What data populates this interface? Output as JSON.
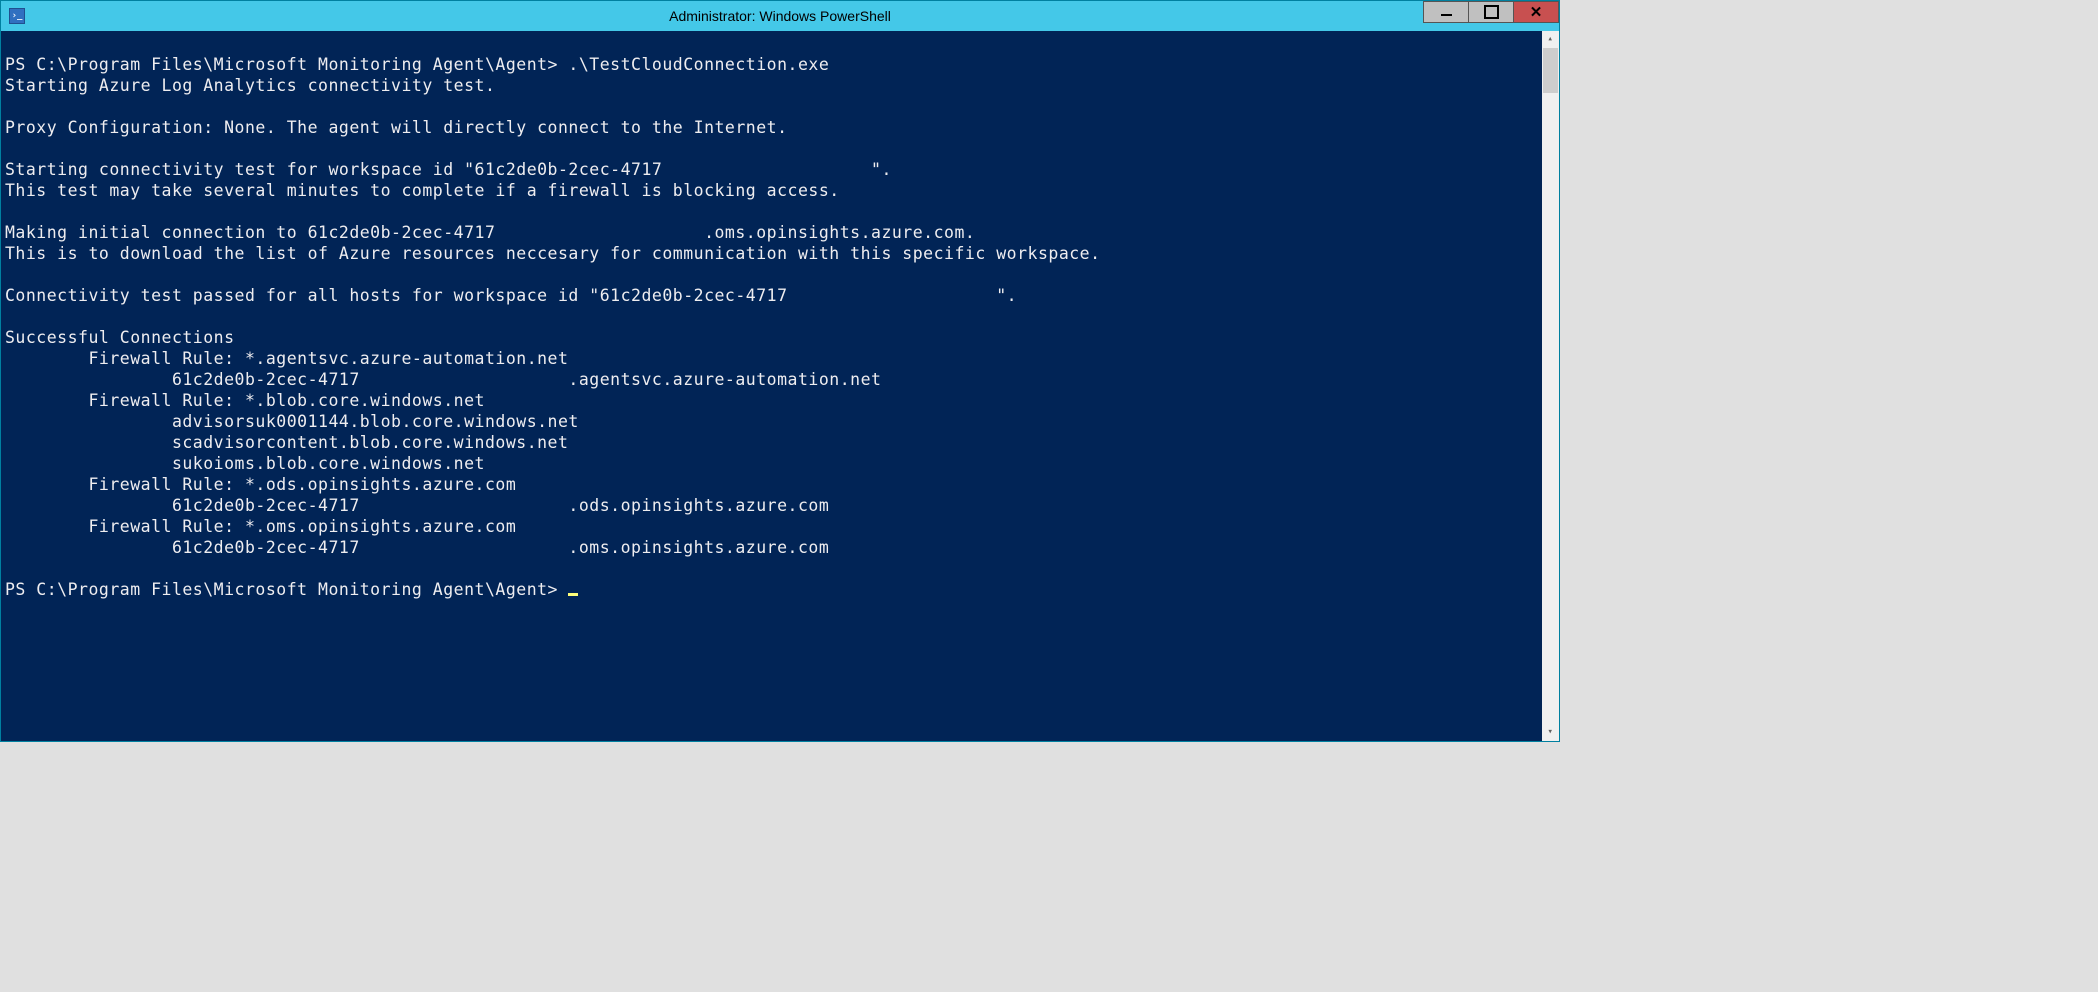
{
  "window": {
    "title": "Administrator: Windows PowerShell"
  },
  "terminal": {
    "prompt1": "PS C:\\Program Files\\Microsoft Monitoring Agent\\Agent> .\\TestCloudConnection.exe",
    "line1": "Starting Azure Log Analytics connectivity test.",
    "line2": "Proxy Configuration: None. The agent will directly connect to the Internet.",
    "line3": "Starting connectivity test for workspace id \"61c2de0b-2cec-4717                    \".",
    "line4": "This test may take several minutes to complete if a firewall is blocking access.",
    "line5": "Making initial connection to 61c2de0b-2cec-4717                    .oms.opinsights.azure.com.",
    "line6": "This is to download the list of Azure resources neccesary for communication with this specific workspace.",
    "line7": "Connectivity test passed for all hosts for workspace id \"61c2de0b-2cec-4717                    \".",
    "line8": "Successful Connections",
    "line9": "        Firewall Rule: *.agentsvc.azure-automation.net",
    "line10": "                61c2de0b-2cec-4717                    .agentsvc.azure-automation.net",
    "line11": "        Firewall Rule: *.blob.core.windows.net",
    "line12": "                advisorsuk0001144.blob.core.windows.net",
    "line13": "                scadvisorcontent.blob.core.windows.net",
    "line14": "                sukoioms.blob.core.windows.net",
    "line15": "        Firewall Rule: *.ods.opinsights.azure.com",
    "line16": "                61c2de0b-2cec-4717                    .ods.opinsights.azure.com",
    "line17": "        Firewall Rule: *.oms.opinsights.azure.com",
    "line18": "                61c2de0b-2cec-4717                    .oms.opinsights.azure.com",
    "prompt2": "PS C:\\Program Files\\Microsoft Monitoring Agent\\Agent> "
  }
}
